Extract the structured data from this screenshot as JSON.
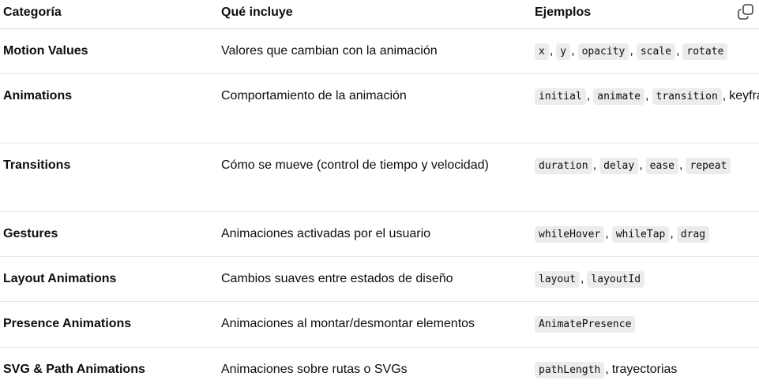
{
  "headers": {
    "category": "Categoría",
    "includes": "Qué incluye",
    "examples": "Ejemplos"
  },
  "rows": [
    {
      "category": "Motion Values",
      "description": "Valores que cambian con la animación",
      "examples": [
        "x",
        "y",
        "opacity",
        "scale",
        "rotate"
      ],
      "suffix": ""
    },
    {
      "category": "Animations",
      "description": "Comportamiento de la animación",
      "examples": [
        "initial",
        "animate",
        "transition"
      ],
      "suffix": "keyframes"
    },
    {
      "category": "Transitions",
      "description": "Cómo se mueve (control de tiempo y velocidad)",
      "examples": [
        "duration",
        "delay",
        "ease",
        "repeat"
      ],
      "suffix": ""
    },
    {
      "category": "Gestures",
      "description": "Animaciones activadas por el usuario",
      "examples": [
        "whileHover",
        "whileTap",
        "drag"
      ],
      "suffix": ""
    },
    {
      "category": "Layout Animations",
      "description": "Cambios suaves entre estados de diseño",
      "examples": [
        "layout",
        "layoutId"
      ],
      "suffix": ""
    },
    {
      "category": "Presence Animations",
      "description": "Animaciones al montar/desmontar elementos",
      "examples": [
        "AnimatePresence"
      ],
      "suffix": ""
    },
    {
      "category": "SVG & Path Animations",
      "description": "Animaciones sobre rutas o SVGs",
      "examples": [
        "pathLength"
      ],
      "suffix": "trayectorias"
    }
  ],
  "icons": {
    "copy": "copy-icon"
  }
}
